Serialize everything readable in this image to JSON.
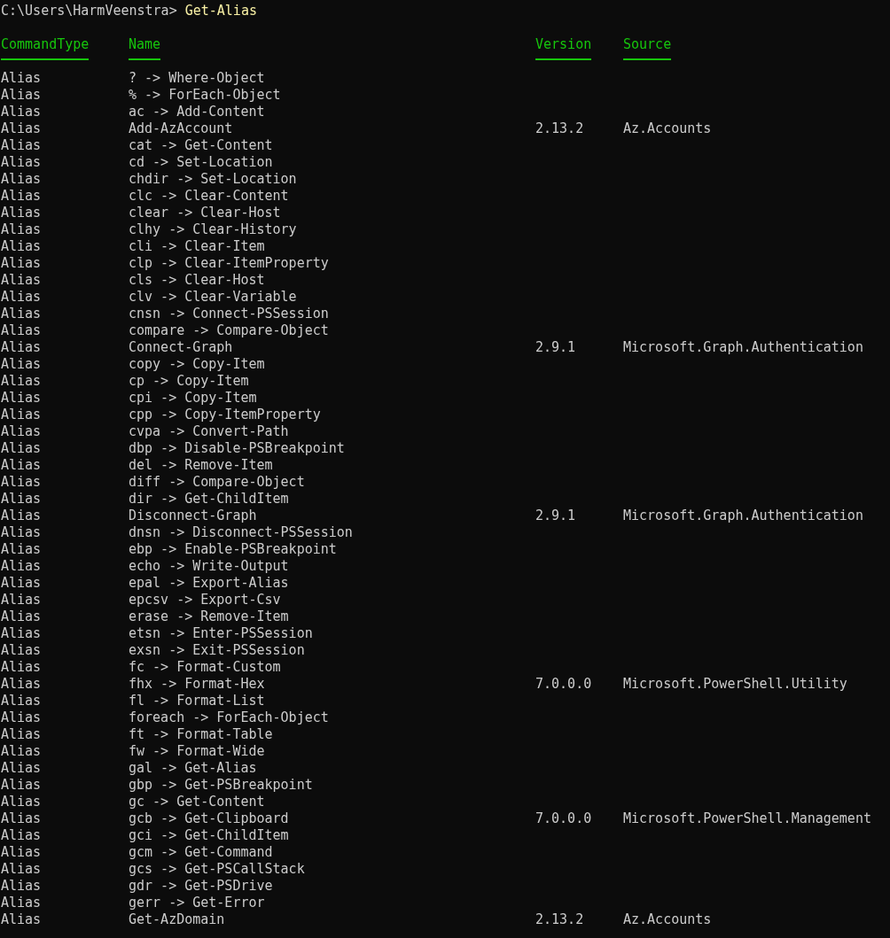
{
  "prompt": {
    "path": "C:\\Users\\HarmVeenstra>",
    "command": "Get-Alias"
  },
  "columns": [
    "CommandType",
    "Name",
    "Version",
    "Source"
  ],
  "rows": [
    {
      "type": "Alias",
      "name": "? -> Where-Object",
      "version": "",
      "source": ""
    },
    {
      "type": "Alias",
      "name": "% -> ForEach-Object",
      "version": "",
      "source": ""
    },
    {
      "type": "Alias",
      "name": "ac -> Add-Content",
      "version": "",
      "source": ""
    },
    {
      "type": "Alias",
      "name": "Add-AzAccount",
      "version": "2.13.2",
      "source": "Az.Accounts"
    },
    {
      "type": "Alias",
      "name": "cat -> Get-Content",
      "version": "",
      "source": ""
    },
    {
      "type": "Alias",
      "name": "cd -> Set-Location",
      "version": "",
      "source": ""
    },
    {
      "type": "Alias",
      "name": "chdir -> Set-Location",
      "version": "",
      "source": ""
    },
    {
      "type": "Alias",
      "name": "clc -> Clear-Content",
      "version": "",
      "source": ""
    },
    {
      "type": "Alias",
      "name": "clear -> Clear-Host",
      "version": "",
      "source": ""
    },
    {
      "type": "Alias",
      "name": "clhy -> Clear-History",
      "version": "",
      "source": ""
    },
    {
      "type": "Alias",
      "name": "cli -> Clear-Item",
      "version": "",
      "source": ""
    },
    {
      "type": "Alias",
      "name": "clp -> Clear-ItemProperty",
      "version": "",
      "source": ""
    },
    {
      "type": "Alias",
      "name": "cls -> Clear-Host",
      "version": "",
      "source": ""
    },
    {
      "type": "Alias",
      "name": "clv -> Clear-Variable",
      "version": "",
      "source": ""
    },
    {
      "type": "Alias",
      "name": "cnsn -> Connect-PSSession",
      "version": "",
      "source": ""
    },
    {
      "type": "Alias",
      "name": "compare -> Compare-Object",
      "version": "",
      "source": ""
    },
    {
      "type": "Alias",
      "name": "Connect-Graph",
      "version": "2.9.1",
      "source": "Microsoft.Graph.Authentication"
    },
    {
      "type": "Alias",
      "name": "copy -> Copy-Item",
      "version": "",
      "source": ""
    },
    {
      "type": "Alias",
      "name": "cp -> Copy-Item",
      "version": "",
      "source": ""
    },
    {
      "type": "Alias",
      "name": "cpi -> Copy-Item",
      "version": "",
      "source": ""
    },
    {
      "type": "Alias",
      "name": "cpp -> Copy-ItemProperty",
      "version": "",
      "source": ""
    },
    {
      "type": "Alias",
      "name": "cvpa -> Convert-Path",
      "version": "",
      "source": ""
    },
    {
      "type": "Alias",
      "name": "dbp -> Disable-PSBreakpoint",
      "version": "",
      "source": ""
    },
    {
      "type": "Alias",
      "name": "del -> Remove-Item",
      "version": "",
      "source": ""
    },
    {
      "type": "Alias",
      "name": "diff -> Compare-Object",
      "version": "",
      "source": ""
    },
    {
      "type": "Alias",
      "name": "dir -> Get-ChildItem",
      "version": "",
      "source": ""
    },
    {
      "type": "Alias",
      "name": "Disconnect-Graph",
      "version": "2.9.1",
      "source": "Microsoft.Graph.Authentication"
    },
    {
      "type": "Alias",
      "name": "dnsn -> Disconnect-PSSession",
      "version": "",
      "source": ""
    },
    {
      "type": "Alias",
      "name": "ebp -> Enable-PSBreakpoint",
      "version": "",
      "source": ""
    },
    {
      "type": "Alias",
      "name": "echo -> Write-Output",
      "version": "",
      "source": ""
    },
    {
      "type": "Alias",
      "name": "epal -> Export-Alias",
      "version": "",
      "source": ""
    },
    {
      "type": "Alias",
      "name": "epcsv -> Export-Csv",
      "version": "",
      "source": ""
    },
    {
      "type": "Alias",
      "name": "erase -> Remove-Item",
      "version": "",
      "source": ""
    },
    {
      "type": "Alias",
      "name": "etsn -> Enter-PSSession",
      "version": "",
      "source": ""
    },
    {
      "type": "Alias",
      "name": "exsn -> Exit-PSSession",
      "version": "",
      "source": ""
    },
    {
      "type": "Alias",
      "name": "fc -> Format-Custom",
      "version": "",
      "source": ""
    },
    {
      "type": "Alias",
      "name": "fhx -> Format-Hex",
      "version": "7.0.0.0",
      "source": "Microsoft.PowerShell.Utility"
    },
    {
      "type": "Alias",
      "name": "fl -> Format-List",
      "version": "",
      "source": ""
    },
    {
      "type": "Alias",
      "name": "foreach -> ForEach-Object",
      "version": "",
      "source": ""
    },
    {
      "type": "Alias",
      "name": "ft -> Format-Table",
      "version": "",
      "source": ""
    },
    {
      "type": "Alias",
      "name": "fw -> Format-Wide",
      "version": "",
      "source": ""
    },
    {
      "type": "Alias",
      "name": "gal -> Get-Alias",
      "version": "",
      "source": ""
    },
    {
      "type": "Alias",
      "name": "gbp -> Get-PSBreakpoint",
      "version": "",
      "source": ""
    },
    {
      "type": "Alias",
      "name": "gc -> Get-Content",
      "version": "",
      "source": ""
    },
    {
      "type": "Alias",
      "name": "gcb -> Get-Clipboard",
      "version": "7.0.0.0",
      "source": "Microsoft.PowerShell.Management"
    },
    {
      "type": "Alias",
      "name": "gci -> Get-ChildItem",
      "version": "",
      "source": ""
    },
    {
      "type": "Alias",
      "name": "gcm -> Get-Command",
      "version": "",
      "source": ""
    },
    {
      "type": "Alias",
      "name": "gcs -> Get-PSCallStack",
      "version": "",
      "source": ""
    },
    {
      "type": "Alias",
      "name": "gdr -> Get-PSDrive",
      "version": "",
      "source": ""
    },
    {
      "type": "Alias",
      "name": "gerr -> Get-Error",
      "version": "",
      "source": ""
    },
    {
      "type": "Alias",
      "name": "Get-AzDomain",
      "version": "2.13.2",
      "source": "Az.Accounts"
    }
  ]
}
